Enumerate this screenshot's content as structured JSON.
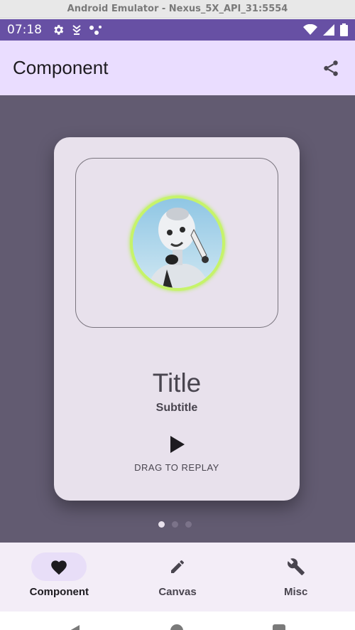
{
  "window": {
    "title": "Android Emulator - Nexus_5X_API_31:5554"
  },
  "status_bar": {
    "time": "07:18",
    "left_icons": [
      "gear-icon",
      "download-icon",
      "assistant-icon"
    ],
    "right_icons": [
      "wifi-icon",
      "signal-icon",
      "battery-icon"
    ]
  },
  "app_bar": {
    "title": "Component",
    "action_icon": "share-icon"
  },
  "card": {
    "title": "Title",
    "subtitle": "Subtitle",
    "action_icon": "play-icon",
    "action_label": "DRAG TO REPLAY",
    "image": "robot-avatar"
  },
  "pager": {
    "count": 3,
    "active_index": 0
  },
  "bottom_nav": {
    "items": [
      {
        "label": "Component",
        "icon": "heart-icon",
        "active": true
      },
      {
        "label": "Canvas",
        "icon": "pencil-icon",
        "active": false
      },
      {
        "label": "Misc",
        "icon": "wrench-icon",
        "active": false
      }
    ]
  },
  "colors": {
    "status_bar": "#6750a4",
    "app_bar": "#eaddff",
    "content_bg": "#625b71",
    "card_bg": "#e8e1ec",
    "avatar_ring": "#c6f36a",
    "bottom_nav_bg": "#f3edf7",
    "nav_indicator": "#e8def8"
  }
}
